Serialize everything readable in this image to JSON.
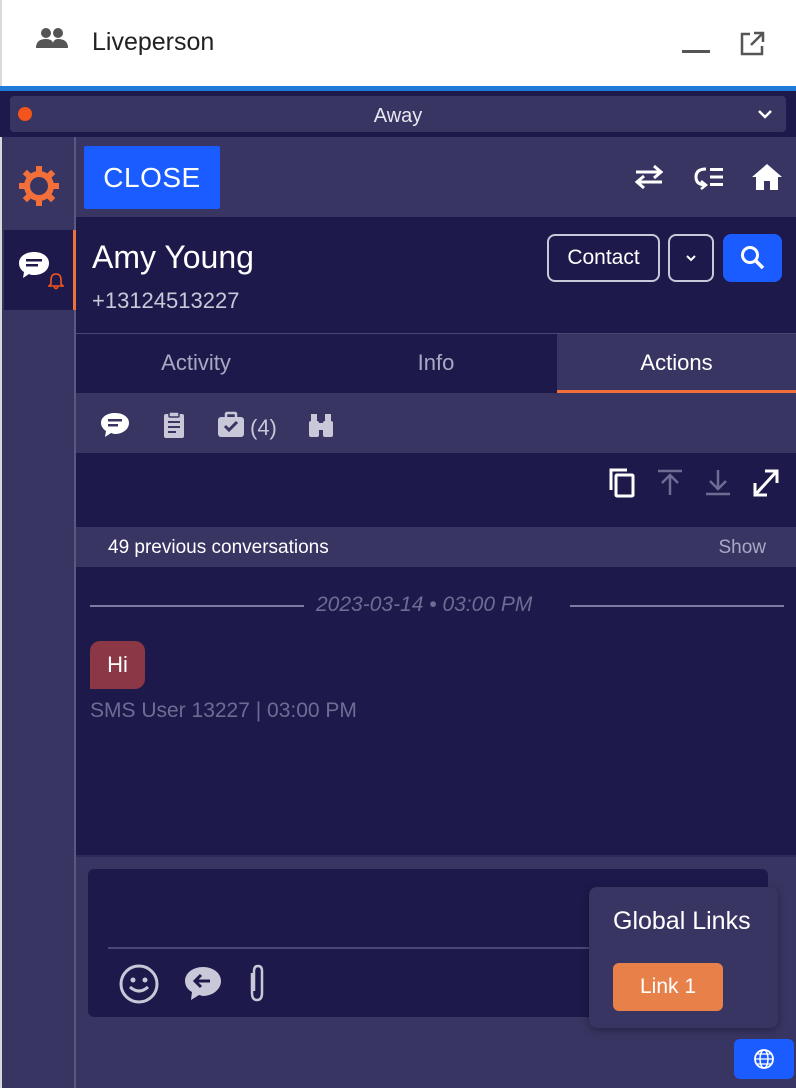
{
  "app": {
    "title": "Liveperson"
  },
  "status": {
    "label": "Away",
    "dot_color": "#f2541b"
  },
  "toolbar": {
    "close_label": "CLOSE"
  },
  "contact": {
    "name": "Amy Young",
    "phone": "+13124513227",
    "contact_button": "Contact"
  },
  "tabs": [
    {
      "label": "Activity",
      "active": false
    },
    {
      "label": "Info",
      "active": false
    },
    {
      "label": "Actions",
      "active": true
    }
  ],
  "subtabs": {
    "tasks_count": "(4)"
  },
  "previous": {
    "text": "49 previous conversations",
    "show_label": "Show"
  },
  "conversation": {
    "date": "2023-03-14 • 03:00 PM",
    "message": "Hi",
    "meta": "SMS User 13227 | 03:00 PM"
  },
  "global_links": {
    "title": "Global Links",
    "link_label": "Link 1"
  },
  "colors": {
    "accent_orange": "#f26f3a",
    "primary_blue": "#1a5cff",
    "panel_dark": "#1d1a4b",
    "panel_mid": "#383563",
    "bubble": "#8c3745",
    "link_button": "#e8804a"
  }
}
